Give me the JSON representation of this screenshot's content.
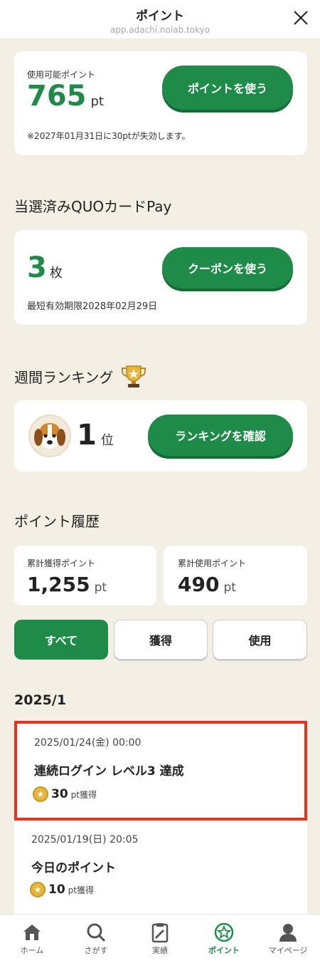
{
  "header": {
    "title": "ポイント",
    "url": "app.adachi.nolab.tokyo"
  },
  "points": {
    "label": "使用可能ポイント",
    "value": "765",
    "unit": "pt",
    "button": "ポイントを使う",
    "notice": "※2027年01月31日に30ptが失効します。"
  },
  "quo": {
    "section_title": "当選済みQUOカードPay",
    "count": "3",
    "unit": "枚",
    "button": "クーポンを使う",
    "expiry": "最短有効期限2028年02月29日"
  },
  "ranking": {
    "section_title": "週間ランキング",
    "rank": "1",
    "unit": "位",
    "button": "ランキングを確認"
  },
  "history": {
    "section_title": "ポイント履歴",
    "earned_label": "累計獲得ポイント",
    "earned_value": "1,255",
    "used_label": "累計使用ポイント",
    "used_value": "490",
    "unit": "pt",
    "tabs": [
      "すべて",
      "獲得",
      "使用"
    ],
    "month": "2025/1",
    "entries": [
      {
        "date": "2025/01/24(金) 00:00",
        "name": "連続ログイン レベル3 達成",
        "points": "30",
        "suffix": "pt獲得"
      },
      {
        "date": "2025/01/19(日) 20:05",
        "name": "今日のポイント",
        "points": "10",
        "suffix": "pt獲得"
      }
    ]
  },
  "nav": [
    {
      "label": "ホーム",
      "icon": "home-icon"
    },
    {
      "label": "さがす",
      "icon": "search-icon"
    },
    {
      "label": "実績",
      "icon": "clipboard-icon"
    },
    {
      "label": "ポイント",
      "icon": "star-coin-icon"
    },
    {
      "label": "マイページ",
      "icon": "user-icon"
    }
  ],
  "colors": {
    "accent": "#1e8c48",
    "background": "#f4efe4",
    "highlight": "#e8321e"
  }
}
